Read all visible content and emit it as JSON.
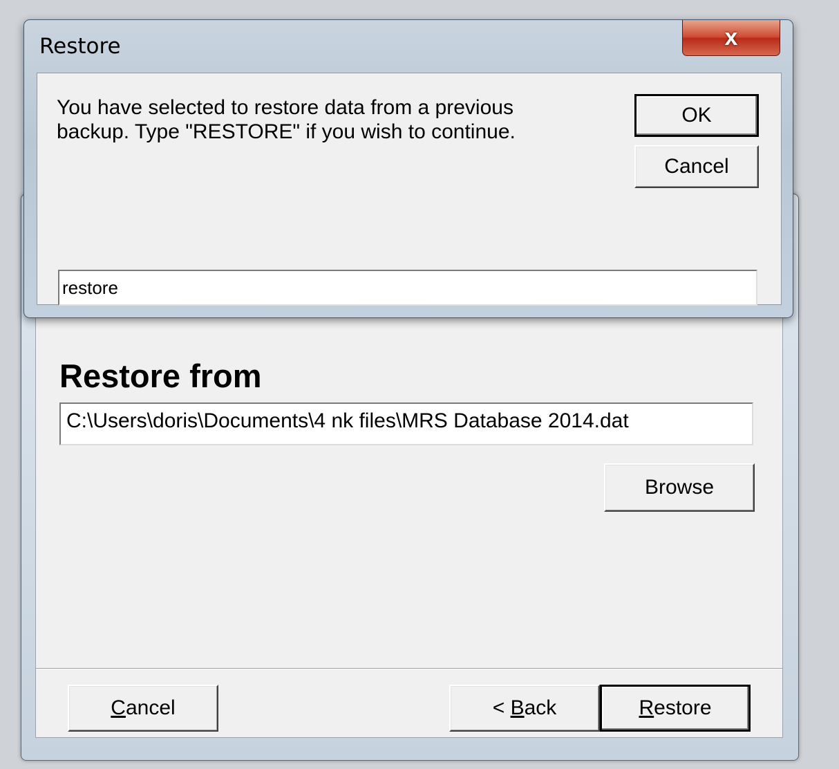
{
  "wizard": {
    "heading": "Restore from",
    "path_value": "C:\\Users\\doris\\Documents\\4 nk files\\MRS Database 2014.dat",
    "browse_label": "Browse",
    "cancel": {
      "accel": "C",
      "rest": "ancel"
    },
    "back": {
      "prefix": "< ",
      "accel": "B",
      "rest": "ack"
    },
    "restore": {
      "accel": "R",
      "rest": "estore"
    }
  },
  "dialog": {
    "title": "Restore",
    "close_glyph": "x",
    "message": "You have selected to restore data from a previous backup. Type \"RESTORE\" if you wish to continue.",
    "ok_label": "OK",
    "cancel_label": "Cancel",
    "input_value": "restore"
  },
  "colors": {
    "close_button": "#c8402a",
    "dialog_frame": "#b9c7d5",
    "client_background": "#f0f0f0"
  }
}
